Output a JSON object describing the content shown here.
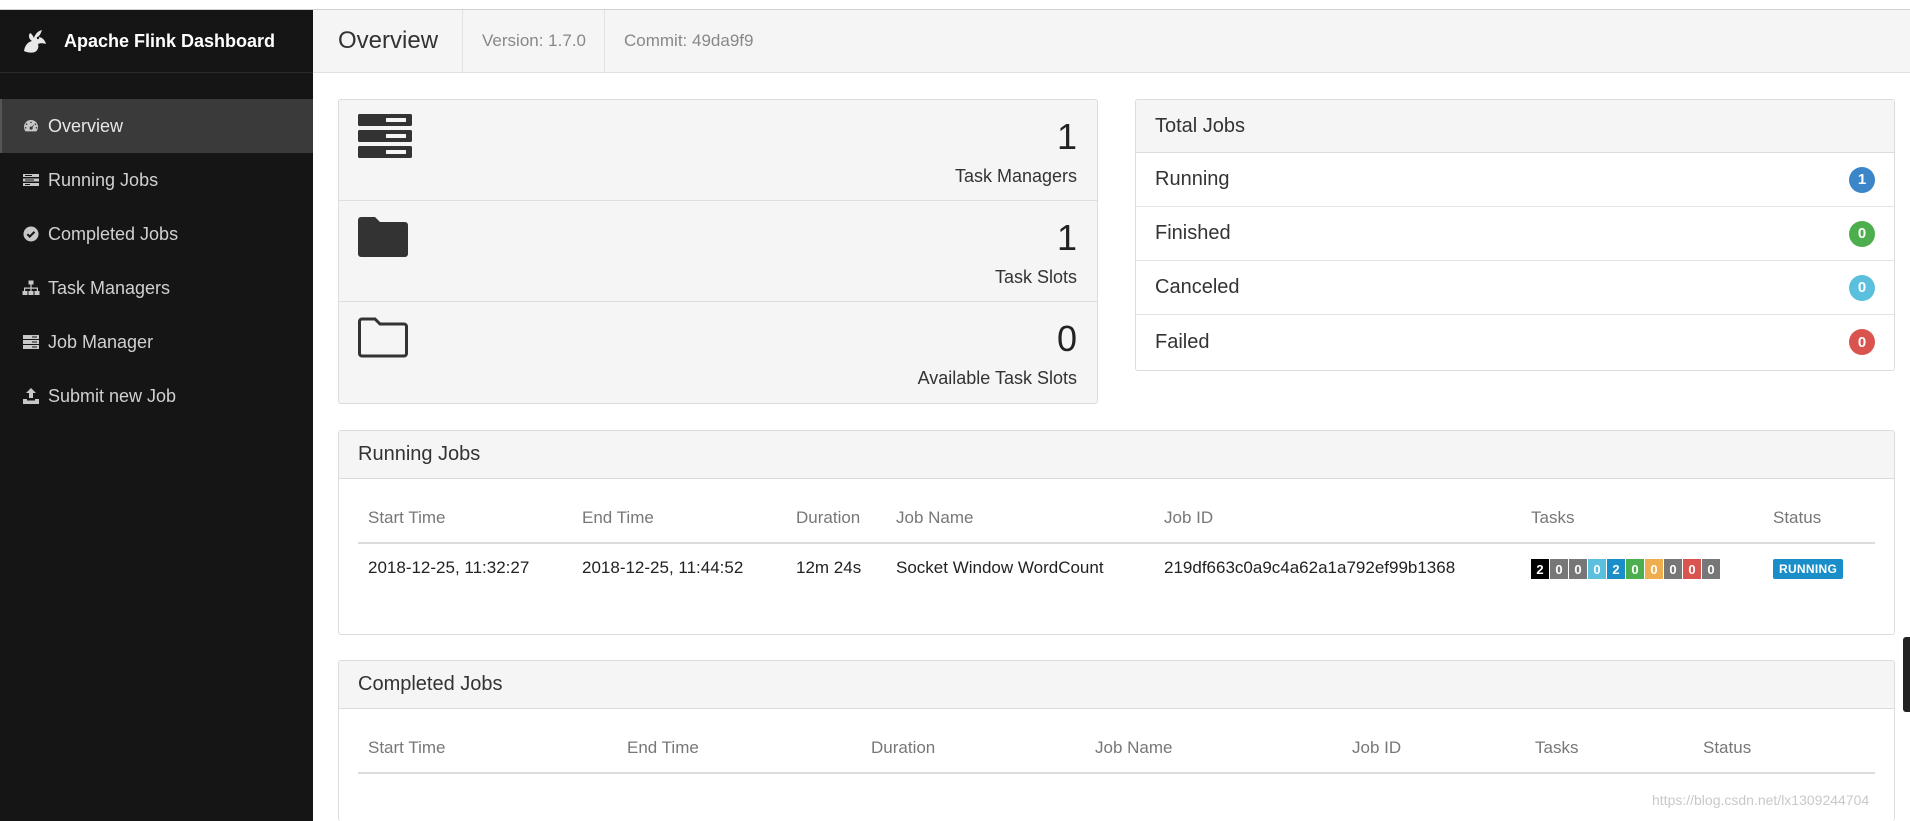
{
  "app": {
    "title": "Apache Flink Dashboard"
  },
  "sidebar": {
    "items": [
      {
        "label": "Overview",
        "icon": "dashboard-icon",
        "active": true
      },
      {
        "label": "Running Jobs",
        "icon": "tasks-icon"
      },
      {
        "label": "Completed Jobs",
        "icon": "check-circle-icon"
      },
      {
        "label": "Task Managers",
        "icon": "sitemap-icon"
      },
      {
        "label": "Job Manager",
        "icon": "server-icon"
      },
      {
        "label": "Submit new Job",
        "icon": "upload-icon"
      }
    ]
  },
  "header": {
    "title": "Overview",
    "version": "Version: 1.7.0",
    "commit": "Commit: 49da9f9"
  },
  "stats": [
    {
      "value": "1",
      "label": "Task Managers",
      "icon": "server-stack-icon"
    },
    {
      "value": "1",
      "label": "Task Slots",
      "icon": "folder-icon"
    },
    {
      "value": "0",
      "label": "Available Task Slots",
      "icon": "folder-open-icon"
    }
  ],
  "total_jobs": {
    "title": "Total Jobs",
    "rows": [
      {
        "label": "Running",
        "count": "1",
        "color": "#3a86c8"
      },
      {
        "label": "Finished",
        "count": "0",
        "color": "#4cae4c"
      },
      {
        "label": "Canceled",
        "count": "0",
        "color": "#5bc0de"
      },
      {
        "label": "Failed",
        "count": "0",
        "color": "#d9534f"
      }
    ]
  },
  "running_jobs": {
    "title": "Running Jobs",
    "columns": [
      "Start Time",
      "End Time",
      "Duration",
      "Job Name",
      "Job ID",
      "Tasks",
      "Status"
    ],
    "rows": [
      {
        "start": "2018-12-25, 11:32:27",
        "end": "2018-12-25, 11:44:52",
        "duration": "12m 24s",
        "name": "Socket Window WordCount",
        "id": "219df663c0a9c4a62a1a792ef99b1368",
        "tasks": [
          {
            "value": "2",
            "color": "#000000"
          },
          {
            "value": "0",
            "color": "#777777"
          },
          {
            "value": "0",
            "color": "#777777"
          },
          {
            "value": "0",
            "color": "#5bc0de"
          },
          {
            "value": "2",
            "color": "#1a8ec9"
          },
          {
            "value": "0",
            "color": "#4cae4c"
          },
          {
            "value": "0",
            "color": "#f0ad4e"
          },
          {
            "value": "0",
            "color": "#777777"
          },
          {
            "value": "0",
            "color": "#d9534f"
          },
          {
            "value": "0",
            "color": "#777777"
          }
        ],
        "status": "RUNNING"
      }
    ]
  },
  "completed_jobs": {
    "title": "Completed Jobs",
    "columns": [
      "Start Time",
      "End Time",
      "Duration",
      "Job Name",
      "Job ID",
      "Tasks",
      "Status"
    ]
  },
  "watermark": "https://blog.csdn.net/lx1309244704"
}
